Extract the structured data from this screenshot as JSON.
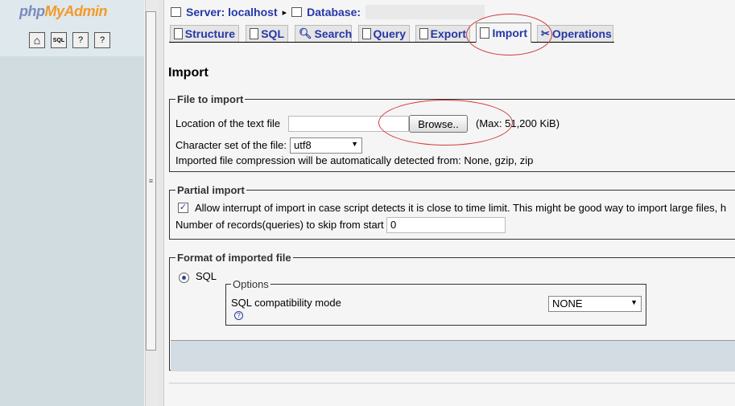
{
  "nav": {
    "logo_php": "php",
    "logo_my": "My",
    "logo_admin": "Admin",
    "home_icon_label": "⌂",
    "sql_icon_label": "SQL",
    "docs_icon_label": "?",
    "docs2_icon_label": "?"
  },
  "breadcrumb": {
    "server": "Server: localhost",
    "separator": "▸",
    "database": "Database:"
  },
  "tabs": [
    {
      "label": "Structure"
    },
    {
      "label": "SQL"
    },
    {
      "label": "Search"
    },
    {
      "label": "Query"
    },
    {
      "label": "Export"
    },
    {
      "label": "Import"
    },
    {
      "label": "Operations"
    }
  ],
  "page_title": "Import",
  "file_to_import": {
    "legend": "File to import",
    "location_label": "Location of the text file",
    "browse_label": "Browse..",
    "max_text": "(Max: 51,200 KiB)",
    "charset_label": "Character set of the file:",
    "charset_value": "utf8",
    "compression_note": "Imported file compression will be automatically detected from: None, gzip, zip"
  },
  "partial_import": {
    "legend": "Partial import",
    "allow_interrupt_label": "Allow interrupt of import in case script detects it is close to time limit. This might be good way to import large files, h",
    "skip_label": "Number of records(queries) to skip from start",
    "skip_value": "0"
  },
  "format": {
    "legend": "Format of imported file",
    "sql_label": "SQL",
    "options_legend": "Options",
    "compat_label": "SQL compatibility mode",
    "compat_value": "NONE",
    "help_icon": "?"
  },
  "colors": {
    "link": "#2537a6",
    "annotation": "#d23b3b",
    "footer_bar": "#d3dce3"
  }
}
